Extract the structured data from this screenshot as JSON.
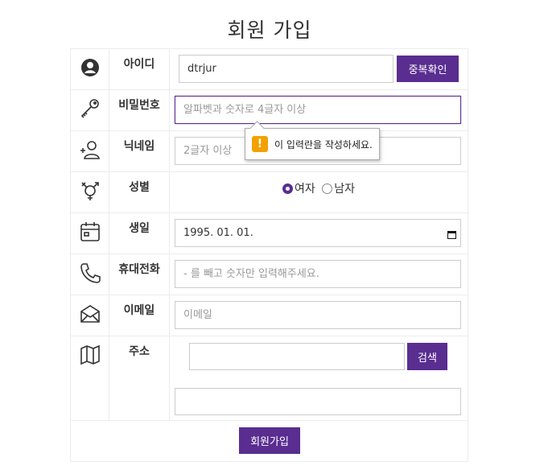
{
  "page": {
    "title": "회원 가입"
  },
  "rows": {
    "id": {
      "label": "아이디",
      "value": "dtrjur",
      "button": "중복확인"
    },
    "password": {
      "label": "비밀번호",
      "placeholder": "알파벳과 숫자로 4글자 이상"
    },
    "nickname": {
      "label": "닉네임",
      "placeholder": "2글자 이상"
    },
    "gender": {
      "label": "성별",
      "options": [
        "여자",
        "남자"
      ],
      "selected": "여자"
    },
    "birthday": {
      "label": "생일",
      "value": "1995. 01. 01."
    },
    "phone": {
      "label": "휴대전화",
      "placeholder": "- 를 빼고 숫자만 입력해주세요."
    },
    "email": {
      "label": "이메일",
      "placeholder": "이메일"
    },
    "address": {
      "label": "주소",
      "search_button": "검색"
    }
  },
  "tooltip": {
    "message": "이 입력란을 작성하세요.",
    "icon": "warning-icon"
  },
  "submit": {
    "label": "회원가입"
  },
  "colors": {
    "accent": "#5a2d91",
    "warning": "#f2a100"
  }
}
